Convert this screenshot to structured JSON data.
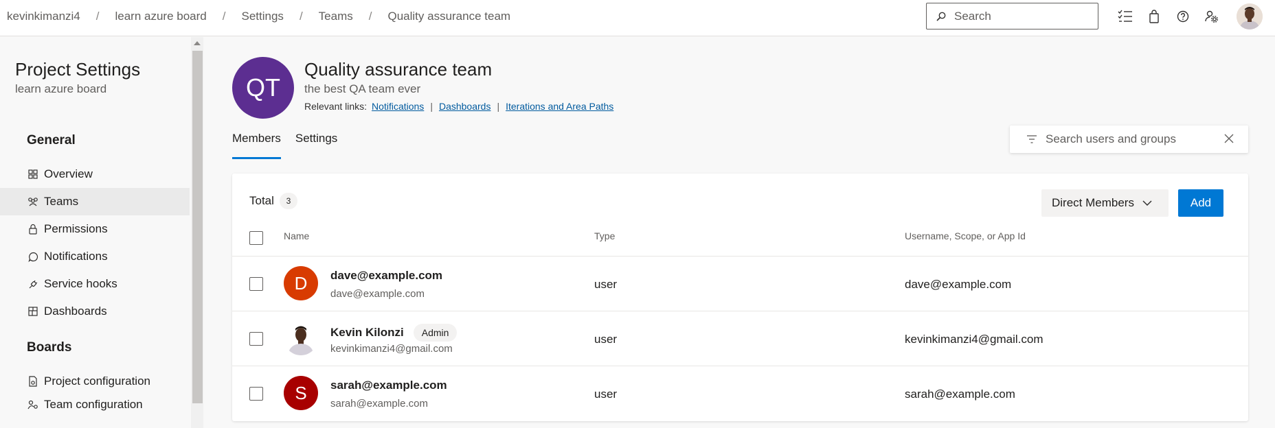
{
  "breadcrumb": [
    "kevinkimanzi4",
    "learn azure board",
    "Settings",
    "Teams",
    "Quality assurance team"
  ],
  "header": {
    "search_placeholder": "Search",
    "icons": [
      "task-list-icon",
      "shopping-bag-icon",
      "help-icon",
      "user-settings-icon"
    ]
  },
  "sidebar": {
    "title": "Project Settings",
    "subtitle": "learn azure board",
    "sections": [
      {
        "heading": "General",
        "items": [
          {
            "label": "Overview",
            "icon": "overview-icon",
            "active": false
          },
          {
            "label": "Teams",
            "icon": "teams-icon",
            "active": true
          },
          {
            "label": "Permissions",
            "icon": "lock-icon",
            "active": false
          },
          {
            "label": "Notifications",
            "icon": "chat-bubble-icon",
            "active": false
          },
          {
            "label": "Service hooks",
            "icon": "plug-icon",
            "active": false
          },
          {
            "label": "Dashboards",
            "icon": "dashboard-icon",
            "active": false
          }
        ]
      },
      {
        "heading": "Boards",
        "items": [
          {
            "label": "Project configuration",
            "icon": "document-gear-icon",
            "active": false
          },
          {
            "label": "Team configuration",
            "icon": "team-gear-icon",
            "active": false
          }
        ]
      }
    ]
  },
  "team": {
    "initials": "QT",
    "name": "Quality assurance team",
    "description": "the best QA team ever",
    "relevant_links_label": "Relevant links:",
    "links": [
      "Notifications",
      "Dashboards",
      "Iterations and Area Paths"
    ],
    "avatar_color": "#5c2e91"
  },
  "tabs": [
    {
      "label": "Members",
      "active": true
    },
    {
      "label": "Settings",
      "active": false
    }
  ],
  "member_search": {
    "placeholder": "Search users and groups"
  },
  "members_table": {
    "total_label": "Total",
    "total_count": "3",
    "filter_dropdown": "Direct Members",
    "add_label": "Add",
    "columns": [
      "Name",
      "Type",
      "Username, Scope, or App Id"
    ],
    "rows": [
      {
        "initial": "D",
        "name": "dave@example.com",
        "email": "dave@example.com",
        "badge": "",
        "type": "user",
        "username": "dave@example.com",
        "avatar_color": "#d83b01"
      },
      {
        "initial": "",
        "name": "Kevin Kilonzi",
        "email": "kevinkimanzi4@gmail.com",
        "badge": "Admin",
        "type": "user",
        "username": "kevinkimanzi4@gmail.com",
        "avatar_color": "#e9dfd6"
      },
      {
        "initial": "S",
        "name": "sarah@example.com",
        "email": "sarah@example.com",
        "badge": "",
        "type": "user",
        "username": "sarah@example.com",
        "avatar_color": "#a80000"
      }
    ]
  },
  "colors": {
    "accent": "#0078d4",
    "link": "#005a9e"
  }
}
